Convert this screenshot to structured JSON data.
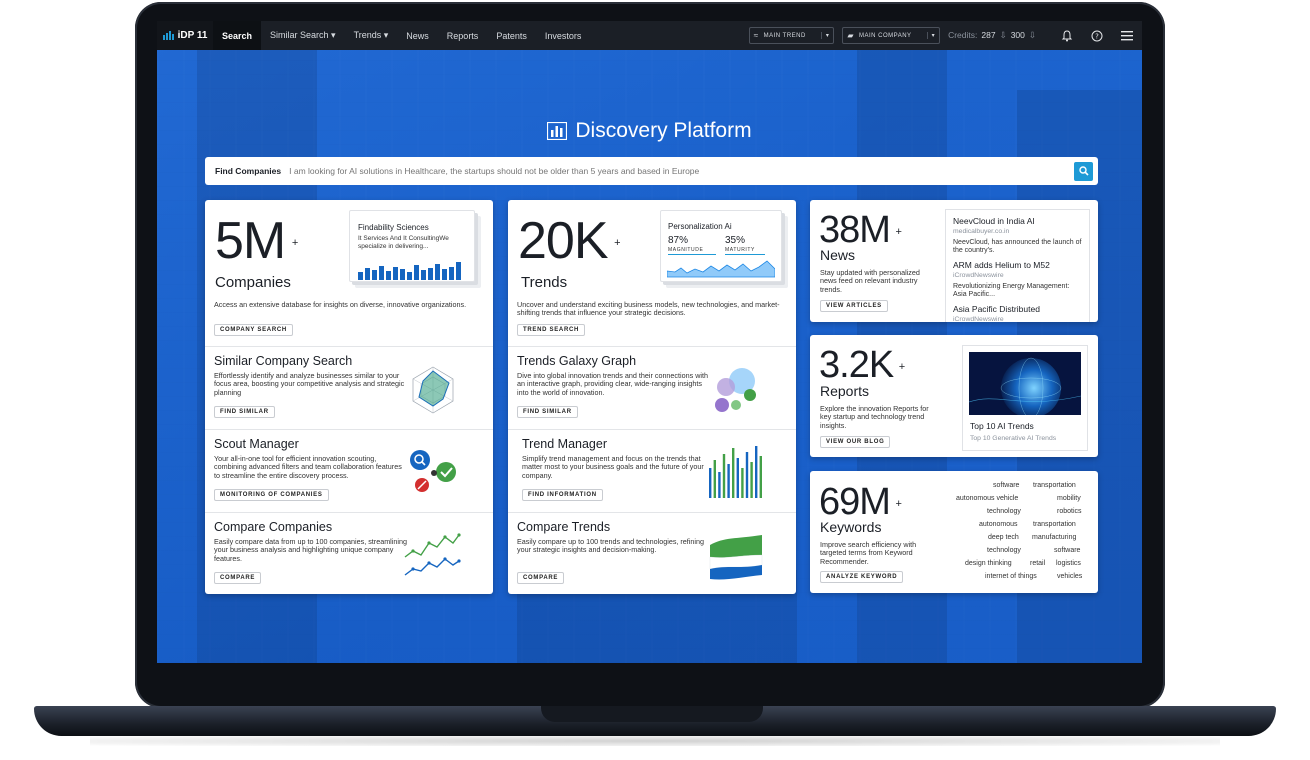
{
  "nav": {
    "brand": "iDP 11",
    "items": [
      "Search",
      "Similar Search ▾",
      "Trends ▾",
      "News",
      "Reports",
      "Patents",
      "Investors"
    ],
    "main_trend": "MAIN TREND",
    "main_company": "MAIN COMPANY",
    "credits_label": "Credits:",
    "credits_value": "287",
    "credits_value2": "300"
  },
  "hero": {
    "title": "Discovery Platform",
    "search_label": "Find Companies",
    "search_placeholder": "I am looking for AI solutions in Healthcare, the startups should not be older than 5 years and based in Europe"
  },
  "companies": {
    "big": "5M",
    "plus": "+",
    "label": "Companies",
    "desc": "Access an extensive database for insights on diverse, innovative organizations.",
    "button": "COMPANY SEARCH",
    "preview_title": "Findability Sciences",
    "preview_sub": "It Services And It ConsultingWe specialize in delivering...",
    "sections": [
      {
        "title": "Similar Company Search",
        "desc": "Effortlessly identify and analyze businesses similar to your focus area, boosting your competitive analysis and strategic planning",
        "button": "FIND SIMILAR"
      },
      {
        "title": "Scout Manager",
        "desc": "Your all-in-one tool for efficient innovation scouting, combining advanced filters and team collaboration features to streamline the entire discovery process.",
        "button": "MONITORING OF COMPANIES"
      },
      {
        "title": "Compare Companies",
        "desc": "Easily compare data from up to 100 companies, streamlining your business analysis and highlighting unique company features.",
        "button": "COMPARE"
      }
    ]
  },
  "trends": {
    "big": "20K",
    "plus": "+",
    "label": "Trends",
    "desc": "Uncover and understand exciting business models, new technologies, and market-shifting trends that influence your strategic decisions.",
    "button": "TREND SEARCH",
    "preview_title": "Personalization Ai",
    "magnitude_value": "87%",
    "magnitude_label": "MAGNITUDE",
    "maturity_value": "35%",
    "maturity_label": "MATURITY",
    "sections": [
      {
        "title": "Trends Galaxy Graph",
        "desc": "Dive into global innovation trends and their connections with an interactive graph, providing clear, wide-ranging insights into the world of innovation.",
        "button": "FIND SIMILAR"
      },
      {
        "title": "Trend Manager",
        "desc": "Simplify trend management and focus on the trends that matter most to your business goals and the future of your company.",
        "button": "FIND INFORMATION"
      },
      {
        "title": "Compare Trends",
        "desc": "Easily compare up to 100 trends and technologies, refining your strategic insights and decision-making.",
        "button": "COMPARE"
      }
    ]
  },
  "news": {
    "big": "38M",
    "plus": "+",
    "label": "News",
    "desc": "Stay updated with personalized news feed on relevant industry trends.",
    "button": "VIEW ARTICLES",
    "items": [
      {
        "title": "NeevCloud in India AI",
        "source": "medicalbuyer.co.in",
        "body": "NeevCloud, has announced the launch of the country's."
      },
      {
        "title": "ARM adds Helium to M52",
        "source": "iCrowdNewswire",
        "body": "Revolutionizing Energy Management: Asia Pacific..."
      },
      {
        "title": "Asia Pacific Distributed",
        "source": "iCrowdNewswire",
        "body": ""
      }
    ]
  },
  "reports": {
    "big": "3.2K",
    "plus": "+",
    "label": "Reports",
    "desc": "Explore the innovation Reports for key startup and technology trend insights.",
    "button": "VIEW OUR BLOG",
    "preview_title": "Top 10 AI Trends",
    "preview_sub": "Top 10 Generative AI Trends"
  },
  "keywords": {
    "big": "69M",
    "plus": "+",
    "label": "Keywords",
    "desc": "Improve search efficiency with targeted terms from Keyword Recommender.",
    "button": "ANALYZE KEYWORD",
    "tags": [
      "software",
      "transportation",
      "autonomous vehicle",
      "mobility",
      "technology",
      "robotics",
      "autonomous",
      "transportation",
      "deep tech",
      "manufacturing",
      "technology",
      "software",
      "design thinking",
      "retail",
      "logistics",
      "internet of things",
      "vehicles"
    ]
  },
  "colors": {
    "accent": "#1e9ad6",
    "navbar": "#1b1f26",
    "hero": "#1f64c8",
    "chart_blue": "#1565c0",
    "green": "#43a047"
  }
}
